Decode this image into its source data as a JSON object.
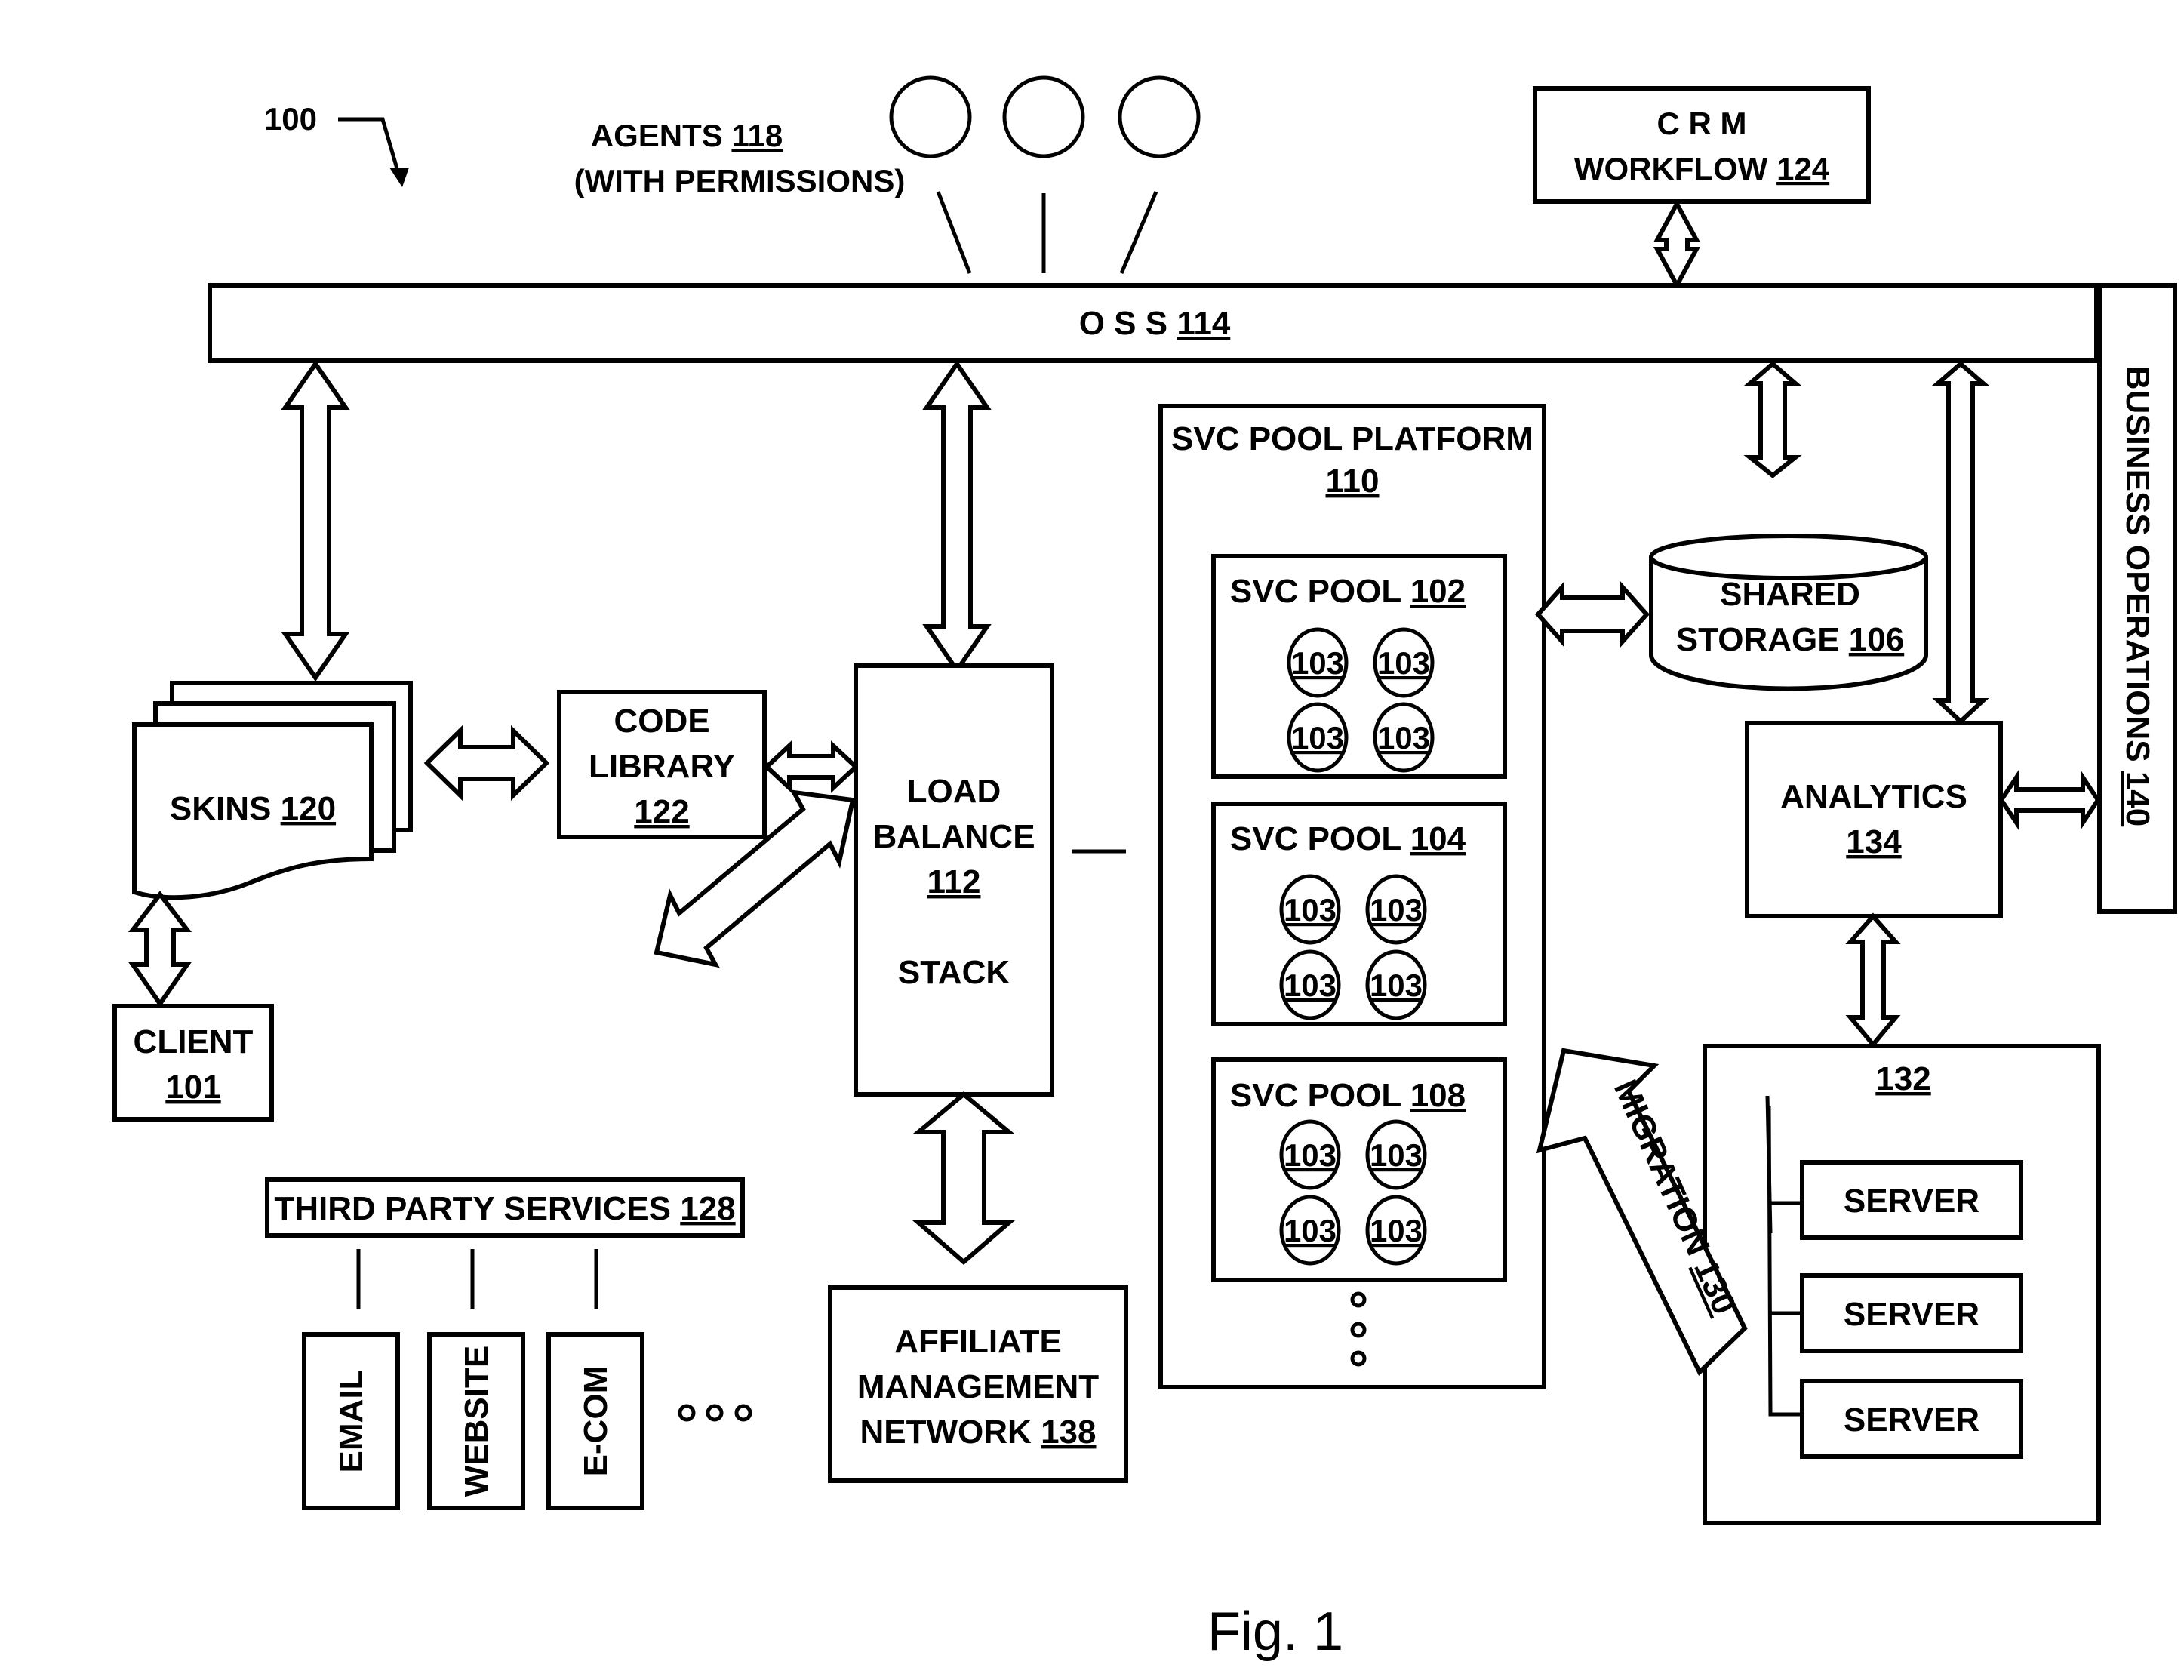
{
  "figure": {
    "ref": "100",
    "caption": "Fig. 1"
  },
  "agents": {
    "label": "AGENTS",
    "ref": "118",
    "sub": "(WITH PERMISSIONS)",
    "count": 3
  },
  "crm": {
    "line1": "C R M",
    "line2": "WORKFLOW",
    "ref": "124"
  },
  "oss": {
    "label": "O S S",
    "ref": "114"
  },
  "business_ops": {
    "label": "BUSINESS OPERATIONS",
    "ref": "140"
  },
  "skins": {
    "label": "SKINS",
    "ref": "120"
  },
  "client": {
    "label": "CLIENT",
    "ref": "101"
  },
  "code_library": {
    "line1": "CODE",
    "line2": "LIBRARY",
    "ref": "122"
  },
  "load_balance": {
    "line1": "LOAD",
    "line2": "BALANCE",
    "ref": "112",
    "line3": "STACK"
  },
  "third_party": {
    "label": "THIRD PARTY SERVICES",
    "ref": "128",
    "items": [
      "EMAIL",
      "WEBSITE",
      "E-COM"
    ],
    "more": "• • •"
  },
  "affiliate": {
    "line1": "AFFILIATE",
    "line2": "MANAGEMENT",
    "line3": "NETWORK",
    "ref": "138"
  },
  "platform": {
    "line1": "SVC POOL PLATFORM",
    "ref": "110"
  },
  "pools": [
    {
      "label": "SVC POOL",
      "ref": "102",
      "nodes": [
        "103",
        "103",
        "103",
        "103"
      ]
    },
    {
      "label": "SVC POOL",
      "ref": "104",
      "nodes": [
        "103",
        "103",
        "103",
        "103"
      ]
    },
    {
      "label": "SVC POOL",
      "ref": "108",
      "nodes": [
        "103",
        "103",
        "103",
        "103"
      ]
    }
  ],
  "shared_storage": {
    "line1": "SHARED",
    "line2": "STORAGE",
    "ref": "106"
  },
  "analytics": {
    "label": "ANALYTICS",
    "ref": "134"
  },
  "server_group": {
    "ref": "132",
    "servers": [
      "SERVER",
      "SERVER",
      "SERVER"
    ]
  },
  "migration": {
    "label": "MIGRATION",
    "ref": "130"
  }
}
